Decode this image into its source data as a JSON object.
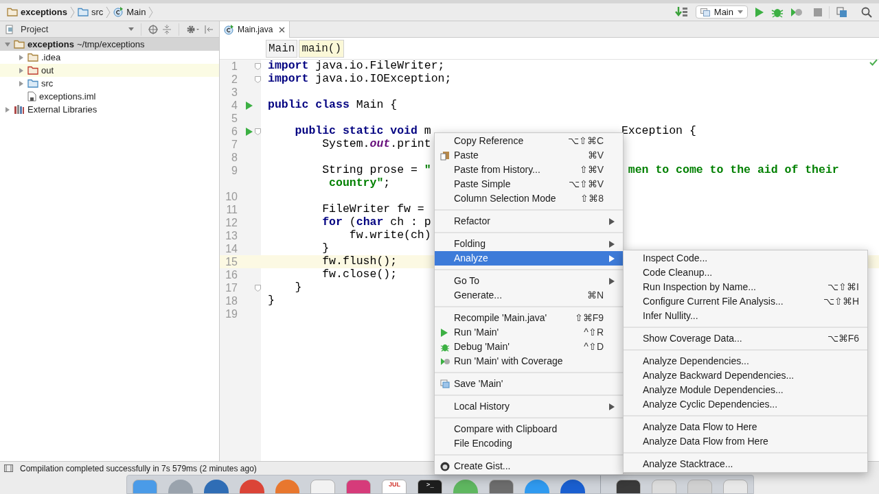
{
  "nav_bar": {
    "crumbs": [
      {
        "label": "exceptions",
        "kind": "project"
      },
      {
        "label": "src",
        "kind": "folder"
      },
      {
        "label": "Main",
        "kind": "class"
      }
    ],
    "run_config": "Main"
  },
  "project_panel": {
    "title": "Project",
    "tree": [
      {
        "label": "exceptions",
        "path": "~/tmp/exceptions",
        "kind": "project",
        "expanded": true,
        "selected": true,
        "highlighted": false,
        "children": [
          {
            "label": ".idea",
            "kind": "folder",
            "expanded": false,
            "selected": false,
            "highlighted": false
          },
          {
            "label": "out",
            "kind": "excluded",
            "expanded": false,
            "selected": false,
            "highlighted": true
          },
          {
            "label": "src",
            "kind": "source",
            "expanded": false,
            "selected": false,
            "highlighted": false
          },
          {
            "label": "exceptions.iml",
            "kind": "file",
            "selected": false,
            "highlighted": false
          }
        ]
      },
      {
        "label": "External Libraries",
        "kind": "library",
        "expanded": false,
        "selected": false,
        "highlighted": false
      }
    ]
  },
  "editor": {
    "tab": {
      "label": "Main.java",
      "selected": true
    },
    "breadcrumbs": [
      {
        "label": "Main",
        "selected": false
      },
      {
        "label": "main()",
        "selected": true
      }
    ],
    "lines": [
      {
        "number": "1",
        "run": false,
        "fold": true,
        "current": false,
        "tokens": [
          {
            "kind": "keyword",
            "text": "import"
          },
          {
            "kind": "plain",
            "text": " java.io.FileWriter;"
          }
        ]
      },
      {
        "number": "2",
        "run": false,
        "fold": true,
        "current": false,
        "tokens": [
          {
            "kind": "keyword",
            "text": "import"
          },
          {
            "kind": "plain",
            "text": " java.io.IOException;"
          }
        ]
      },
      {
        "number": "3",
        "run": false,
        "fold": false,
        "current": false
      },
      {
        "number": "4",
        "run": true,
        "fold": false,
        "current": false,
        "tokens": [
          {
            "kind": "keyword",
            "text": "public class"
          },
          {
            "kind": "plain",
            "text": " Main {"
          }
        ]
      },
      {
        "number": "5",
        "run": false,
        "fold": false,
        "current": false
      },
      {
        "number": "6",
        "run": true,
        "fold": true,
        "current": false,
        "tokens": [
          {
            "kind": "keyword",
            "text": "    public static void"
          },
          {
            "kind": "plain",
            "text": " m"
          }
        ],
        "right_tokens": [
          {
            "kind": "plain",
            "text": "Exception {"
          }
        ]
      },
      {
        "number": "7",
        "run": false,
        "fold": false,
        "current": false,
        "tokens": [
          {
            "kind": "plain",
            "text": "        System."
          },
          {
            "kind": "field",
            "text": "out"
          },
          {
            "kind": "plain",
            "text": ".print"
          }
        ]
      },
      {
        "number": "8",
        "run": false,
        "fold": false,
        "current": false
      },
      {
        "number": "9",
        "run": false,
        "fold": false,
        "current": false,
        "tokens": [
          {
            "kind": "plain",
            "text": "        String prose = "
          },
          {
            "kind": "string",
            "text": "\""
          }
        ],
        "right_tokens": [
          {
            "kind": "string",
            "text": " men to come to the aid of their"
          }
        ],
        "wrap_tokens": [
          {
            "kind": "string",
            "text": "         country\""
          },
          {
            "kind": "plain",
            "text": ";"
          }
        ]
      },
      {
        "number": "10",
        "run": false,
        "fold": false,
        "current": false
      },
      {
        "number": "11",
        "run": false,
        "fold": false,
        "current": false,
        "tokens": [
          {
            "kind": "plain",
            "text": "        FileWriter fw = "
          }
        ]
      },
      {
        "number": "12",
        "run": false,
        "fold": false,
        "current": false,
        "tokens": [
          {
            "kind": "keyword",
            "text": "        for"
          },
          {
            "kind": "plain",
            "text": " ("
          },
          {
            "kind": "keyword",
            "text": "char"
          },
          {
            "kind": "plain",
            "text": " ch : p"
          }
        ]
      },
      {
        "number": "13",
        "run": false,
        "fold": false,
        "current": false,
        "tokens": [
          {
            "kind": "plain",
            "text": "            fw.write(ch)"
          }
        ]
      },
      {
        "number": "14",
        "run": false,
        "fold": false,
        "current": false,
        "tokens": [
          {
            "kind": "plain",
            "text": "        }"
          }
        ]
      },
      {
        "number": "15",
        "run": false,
        "fold": false,
        "current": true,
        "tokens": [
          {
            "kind": "plain",
            "text": "        fw.flush();"
          }
        ]
      },
      {
        "number": "16",
        "run": false,
        "fold": false,
        "current": false,
        "tokens": [
          {
            "kind": "plain",
            "text": "        fw.close();"
          }
        ]
      },
      {
        "number": "17",
        "run": false,
        "fold": true,
        "current": false,
        "tokens": [
          {
            "kind": "plain",
            "text": "    }"
          }
        ]
      },
      {
        "number": "18",
        "run": false,
        "fold": false,
        "current": false,
        "tokens": [
          {
            "kind": "plain",
            "text": "}"
          }
        ]
      },
      {
        "number": "19",
        "run": false,
        "fold": false,
        "current": false
      }
    ]
  },
  "context_menu": [
    {
      "kind": "item",
      "label": "Copy Reference",
      "shortcut": "⌥⇧⌘C",
      "submenu": false,
      "selected": false
    },
    {
      "kind": "paste",
      "label": "Paste",
      "shortcut": "⌘V",
      "submenu": false,
      "selected": false
    },
    {
      "kind": "item",
      "label": "Paste from History...",
      "shortcut": "⇧⌘V",
      "submenu": false,
      "selected": false
    },
    {
      "kind": "item",
      "label": "Paste Simple",
      "shortcut": "⌥⇧⌘V",
      "submenu": false,
      "selected": false
    },
    {
      "kind": "item",
      "label": "Column Selection Mode",
      "shortcut": "⇧⌘8",
      "submenu": false,
      "selected": false
    },
    {
      "kind": "separator"
    },
    {
      "kind": "item",
      "label": "Refactor",
      "submenu": true,
      "selected": false
    },
    {
      "kind": "separator"
    },
    {
      "kind": "item",
      "label": "Folding",
      "submenu": true,
      "selected": false
    },
    {
      "kind": "item",
      "label": "Analyze",
      "submenu": true,
      "selected": true
    },
    {
      "kind": "separator"
    },
    {
      "kind": "item",
      "label": "Go To",
      "submenu": true,
      "selected": false
    },
    {
      "kind": "item",
      "label": "Generate...",
      "shortcut": "⌘N",
      "submenu": false,
      "selected": false
    },
    {
      "kind": "separator"
    },
    {
      "kind": "item",
      "label": "Recompile 'Main.java'",
      "shortcut": "⇧⌘F9",
      "submenu": false,
      "selected": false
    },
    {
      "kind": "run",
      "label": "Run 'Main'",
      "shortcut": "^⇧R",
      "submenu": false,
      "selected": false
    },
    {
      "kind": "debug",
      "label": "Debug 'Main'",
      "shortcut": "^⇧D",
      "submenu": false,
      "selected": false
    },
    {
      "kind": "coverage",
      "label": "Run 'Main' with Coverage",
      "submenu": false,
      "selected": false
    },
    {
      "kind": "separator"
    },
    {
      "kind": "save",
      "label": "Save 'Main'",
      "submenu": false,
      "selected": false
    },
    {
      "kind": "separator"
    },
    {
      "kind": "item",
      "label": "Local History",
      "submenu": true,
      "selected": false
    },
    {
      "kind": "separator"
    },
    {
      "kind": "item",
      "label": "Compare with Clipboard",
      "submenu": false,
      "selected": false
    },
    {
      "kind": "item",
      "label": "File Encoding",
      "submenu": false,
      "selected": false
    },
    {
      "kind": "separator"
    },
    {
      "kind": "gist",
      "label": "Create Gist...",
      "submenu": false,
      "selected": false
    }
  ],
  "analyze_submenu": [
    {
      "kind": "item",
      "label": "Inspect Code..."
    },
    {
      "kind": "item",
      "label": "Code Cleanup..."
    },
    {
      "kind": "item",
      "label": "Run Inspection by Name...",
      "shortcut": "⌥⇧⌘I"
    },
    {
      "kind": "item",
      "label": "Configure Current File Analysis...",
      "shortcut": "⌥⇧⌘H"
    },
    {
      "kind": "item",
      "label": "Infer Nullity..."
    },
    {
      "kind": "separator"
    },
    {
      "kind": "item",
      "label": "Show Coverage Data...",
      "shortcut": "⌥⌘F6"
    },
    {
      "kind": "separator"
    },
    {
      "kind": "item",
      "label": "Analyze Dependencies..."
    },
    {
      "kind": "item",
      "label": "Analyze Backward Dependencies..."
    },
    {
      "kind": "item",
      "label": "Analyze Module Dependencies..."
    },
    {
      "kind": "item",
      "label": "Analyze Cyclic Dependencies..."
    },
    {
      "kind": "separator"
    },
    {
      "kind": "item",
      "label": "Analyze Data Flow to Here"
    },
    {
      "kind": "item",
      "label": "Analyze Data Flow from Here"
    },
    {
      "kind": "separator"
    },
    {
      "kind": "item",
      "label": "Analyze Stacktrace..."
    }
  ],
  "status_bar": {
    "message": "Compilation completed successfully in 7s 579ms (2 minutes ago)"
  },
  "dock": [
    {
      "kind": "square",
      "color": "#4a9be8"
    },
    {
      "kind": "circle",
      "color": "#9aa3ad"
    },
    {
      "kind": "circle",
      "color": "#2f6db5"
    },
    {
      "kind": "circle",
      "color": "#db4437"
    },
    {
      "kind": "circle",
      "color": "#e8772e"
    },
    {
      "kind": "square",
      "color": "#f2f2f2"
    },
    {
      "kind": "square",
      "color": "#d63b7a"
    },
    {
      "kind": "calendar",
      "color": "#ffffff",
      "label": "JUL"
    },
    {
      "kind": "terminal",
      "color": "#1e1e1e",
      "label": ">_"
    },
    {
      "kind": "circle",
      "color": "#5fb760"
    },
    {
      "kind": "square",
      "color": "#6d6d6d"
    },
    {
      "kind": "circle",
      "color": "#2f9af0"
    },
    {
      "kind": "circle",
      "color": "#1a5fd0"
    },
    {
      "kind": "divider"
    },
    {
      "kind": "square",
      "color": "#3a3a3a"
    },
    {
      "kind": "square",
      "color": "#dcdcdc"
    },
    {
      "kind": "square",
      "color": "#d0d0d0"
    },
    {
      "kind": "trash",
      "color": "#e8e8e8"
    }
  ]
}
